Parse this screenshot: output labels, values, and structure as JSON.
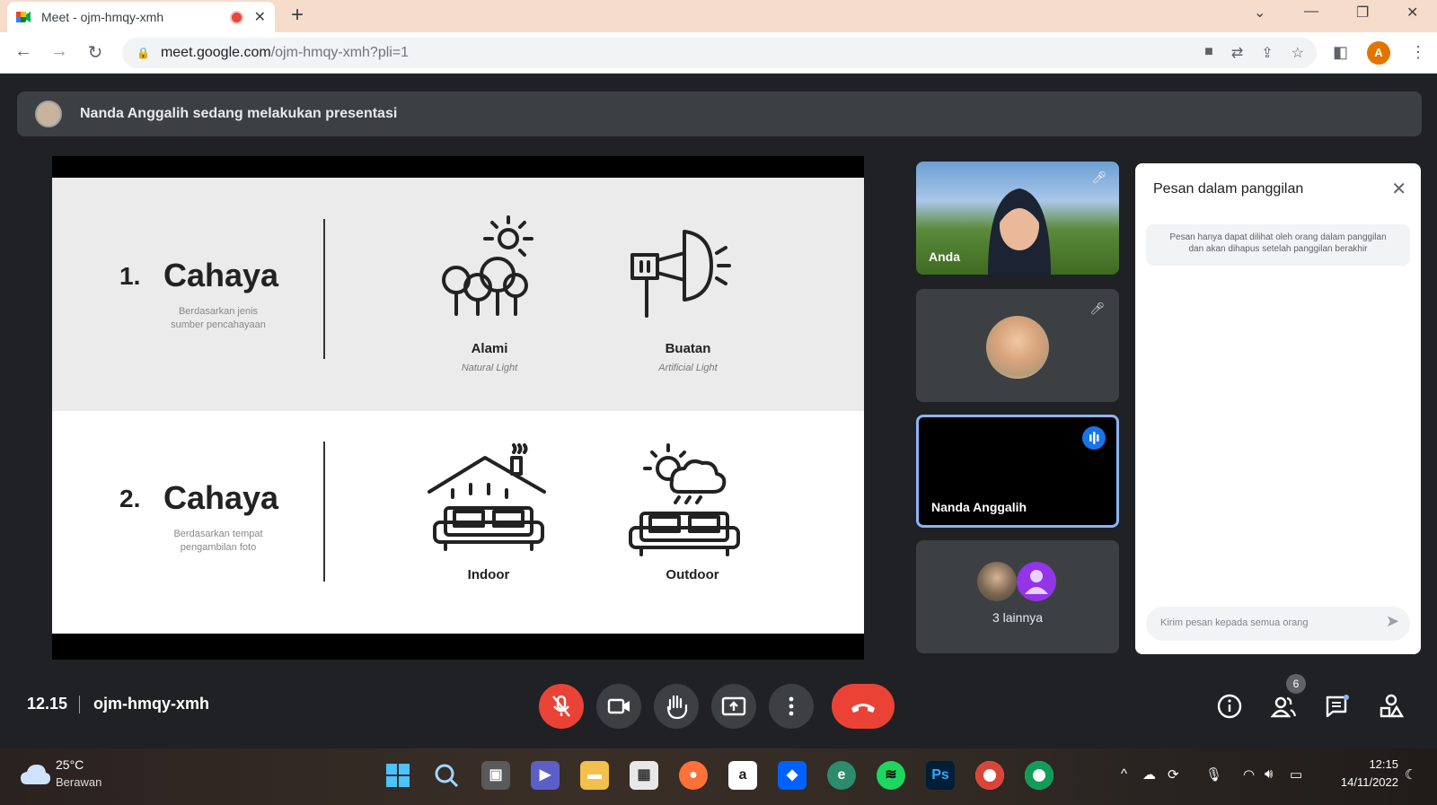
{
  "browser": {
    "tab_title": "Meet - ojm-hmqy-xmh",
    "tab_close": "✕",
    "new_tab": "+",
    "url_host": "meet.google.com",
    "url_path": "/ojm-hmqy-xmh?pli=1",
    "profile_initial": "A"
  },
  "banner": {
    "text": "Nanda Anggalih sedang melakukan presentasi"
  },
  "slide": {
    "rows": [
      {
        "number": "1.",
        "title": "Cahaya",
        "subtitle_line1": "Berdasarkan jenis",
        "subtitle_line2": "sumber pencahayaan",
        "left_label": "Alami",
        "left_sub": "Natural Light",
        "right_label": "Buatan",
        "right_sub": "Artificial Light"
      },
      {
        "number": "2.",
        "title": "Cahaya",
        "subtitle_line1": "Berdasarkan tempat",
        "subtitle_line2": "pengambilan foto",
        "left_label": "Indoor",
        "left_sub": "",
        "right_label": "Outdoor",
        "right_sub": ""
      }
    ]
  },
  "participants": {
    "self_label": "Anda",
    "presenter_name": "Nanda Anggalih",
    "others_label": "3 lainnya"
  },
  "chat": {
    "title": "Pesan dalam panggilan",
    "note_line1": "Pesan hanya dapat dilihat oleh orang dalam panggilan",
    "note_line2": "dan akan dihapus setelah panggilan berakhir",
    "input_placeholder": "Kirim pesan kepada semua orang"
  },
  "meeting": {
    "time": "12.15",
    "code": "ojm-hmqy-xmh",
    "people_count": "6"
  },
  "taskbar": {
    "temperature": "25°C",
    "weather": "Berawan",
    "clock": "12:15",
    "date": "14/11/2022",
    "ps_label": "Ps"
  },
  "colors": {
    "accent": "#8ab4f8",
    "danger": "#ea4335",
    "surface": "#3c4043",
    "background": "#202124"
  }
}
